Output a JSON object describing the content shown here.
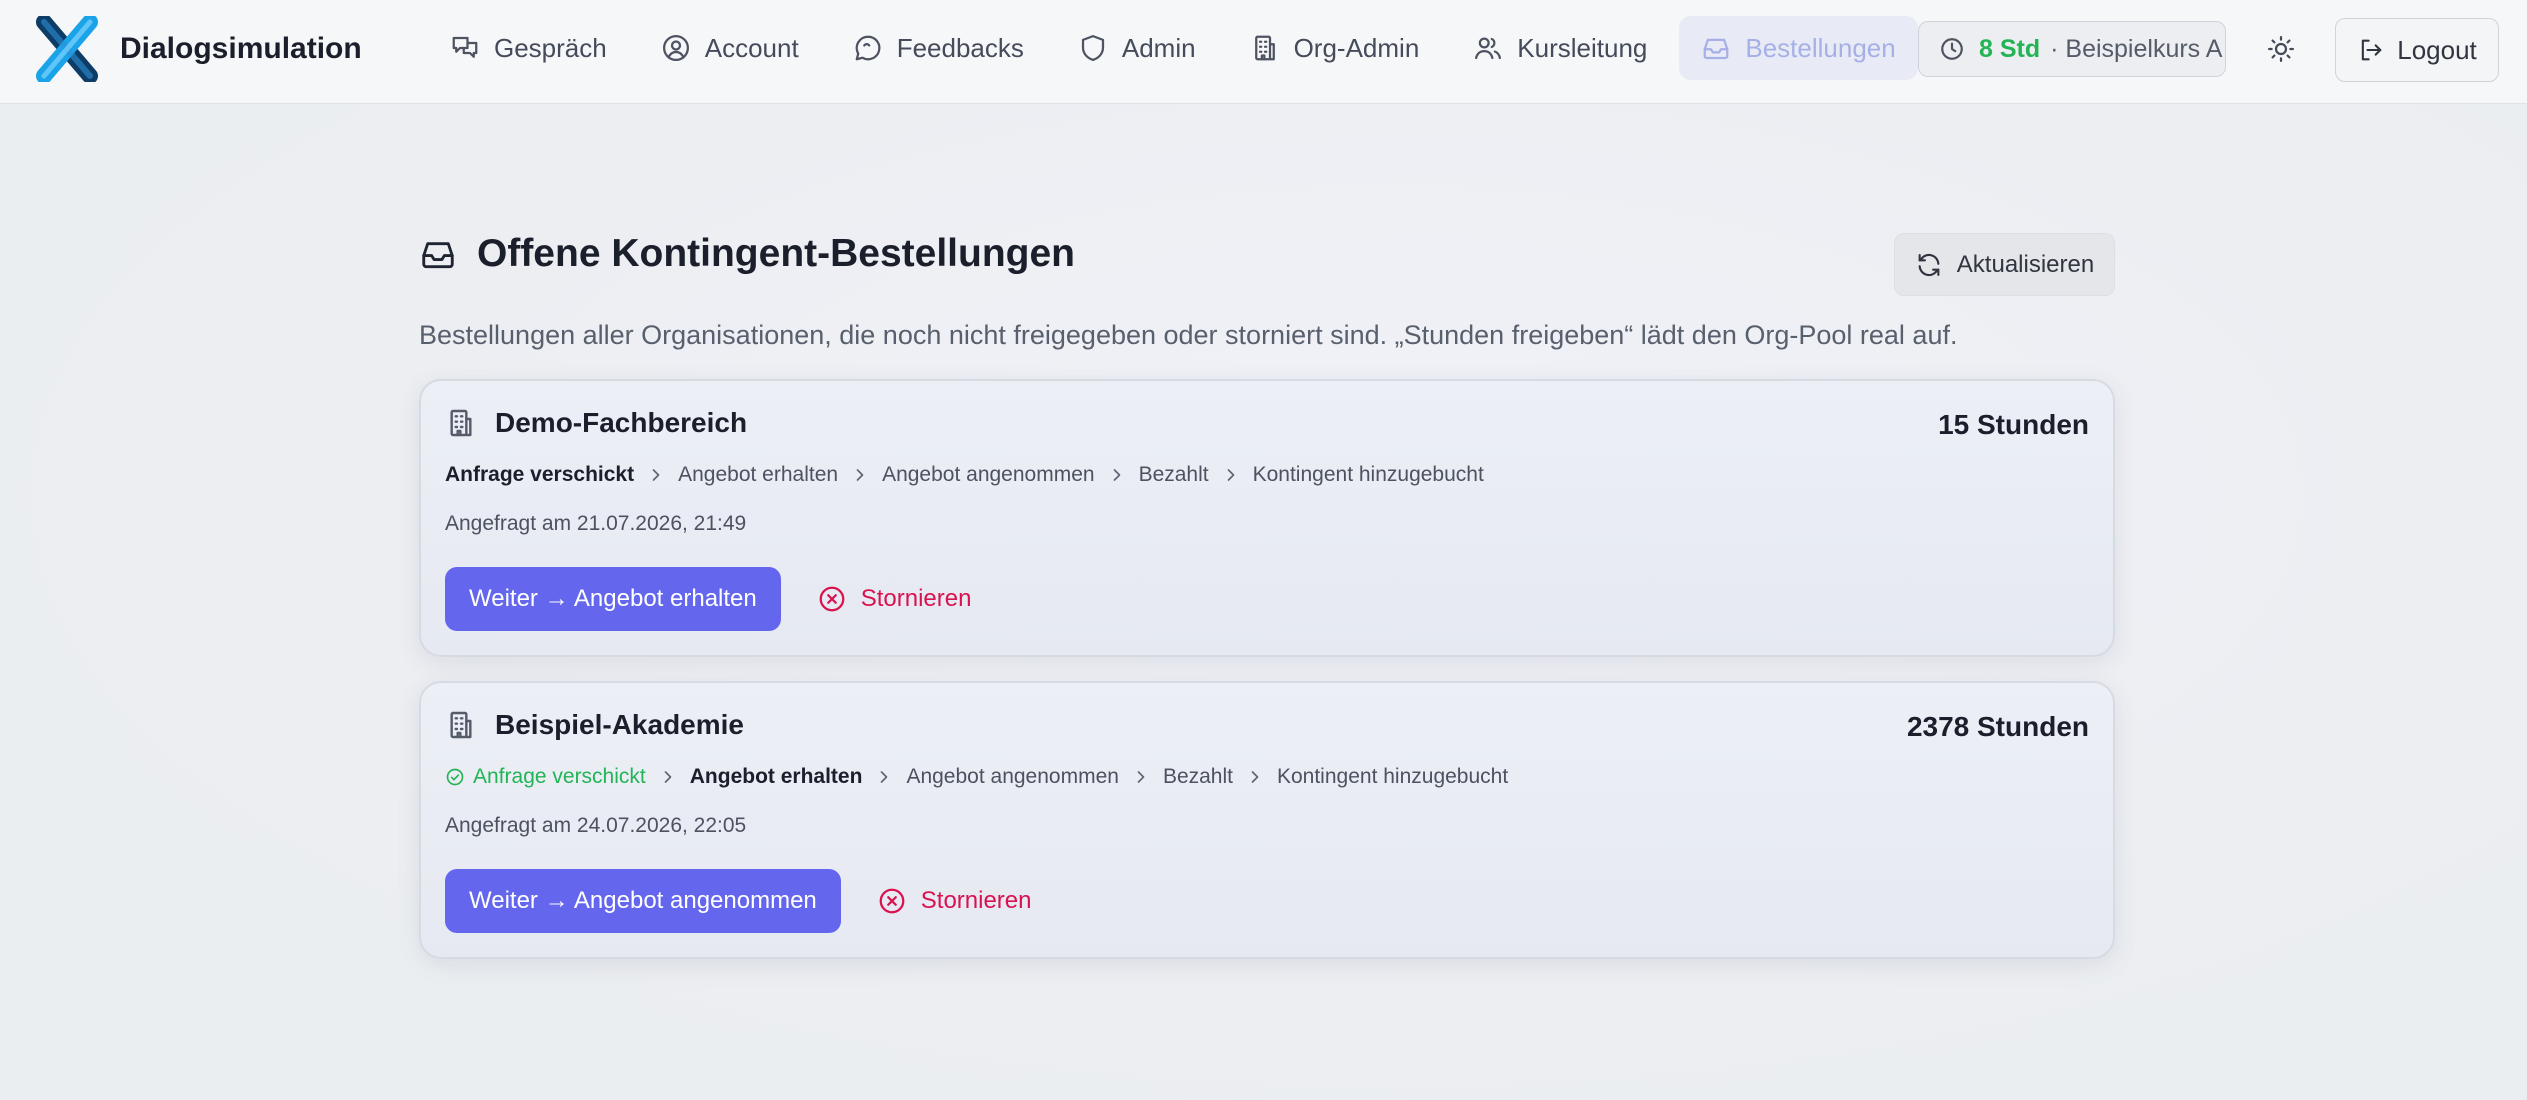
{
  "app": {
    "name": "Dialogsimulation",
    "logo": "x-logo"
  },
  "nav": {
    "items": [
      {
        "label": "Gespräch",
        "icon": "chat-icon",
        "active": false
      },
      {
        "label": "Account",
        "icon": "user-circle-icon",
        "active": false
      },
      {
        "label": "Feedbacks",
        "icon": "message-icon",
        "active": false
      },
      {
        "label": "Admin",
        "icon": "shield-icon",
        "active": false
      },
      {
        "label": "Org-Admin",
        "icon": "building-icon",
        "active": false
      },
      {
        "label": "Kursleitung",
        "icon": "users-icon",
        "active": false
      },
      {
        "label": "Bestellungen",
        "icon": "inbox-icon",
        "active": true
      }
    ]
  },
  "credit": {
    "icon": "clock-icon",
    "hours": "8 Std",
    "course": "· Beispielkurs A"
  },
  "theme_toggle": {
    "icon": "sun-icon"
  },
  "logout": {
    "label": "Logout",
    "icon": "logout-icon"
  },
  "page": {
    "title": "Offene Kontingent-Bestellungen",
    "title_icon": "inbox-icon",
    "description": "Bestellungen aller Organisationen, die noch nicht freigegeben oder storniert sind. „Stunden freigeben“ lädt den Org-Pool real auf.",
    "refresh_label": "Aktualisieren",
    "refresh_icon": "refresh-icon"
  },
  "orders": [
    {
      "org": "Demo-Fachbereich",
      "hours": "15 Stunden",
      "steps": [
        {
          "label": "Anfrage verschickt",
          "state": "current"
        },
        {
          "label": "Angebot erhalten",
          "state": "pending"
        },
        {
          "label": "Angebot angenommen",
          "state": "pending"
        },
        {
          "label": "Bezahlt",
          "state": "pending"
        },
        {
          "label": "Kontingent hinzugebucht",
          "state": "pending"
        }
      ],
      "requested": "Angefragt am 21.07.2026, 21:49",
      "advance_label": "Weiter → Angebot erhalten",
      "cancel_label": "Stornieren"
    },
    {
      "org": "Beispiel-Akademie",
      "hours": "2378 Stunden",
      "steps": [
        {
          "label": "Anfrage verschickt",
          "state": "done"
        },
        {
          "label": "Angebot erhalten",
          "state": "current"
        },
        {
          "label": "Angebot angenommen",
          "state": "pending"
        },
        {
          "label": "Bezahlt",
          "state": "pending"
        },
        {
          "label": "Kontingent hinzugebucht",
          "state": "pending"
        }
      ],
      "requested": "Angefragt am 24.07.2026, 22:05",
      "advance_label": "Weiter → Angebot angenommen",
      "cancel_label": "Stornieren"
    }
  ],
  "colors": {
    "accent": "#6467ee",
    "nav_active_bg": "#e8ebf6",
    "nav_active_text": "#a7b0e6",
    "success": "#22b455",
    "danger": "#d9134f"
  }
}
